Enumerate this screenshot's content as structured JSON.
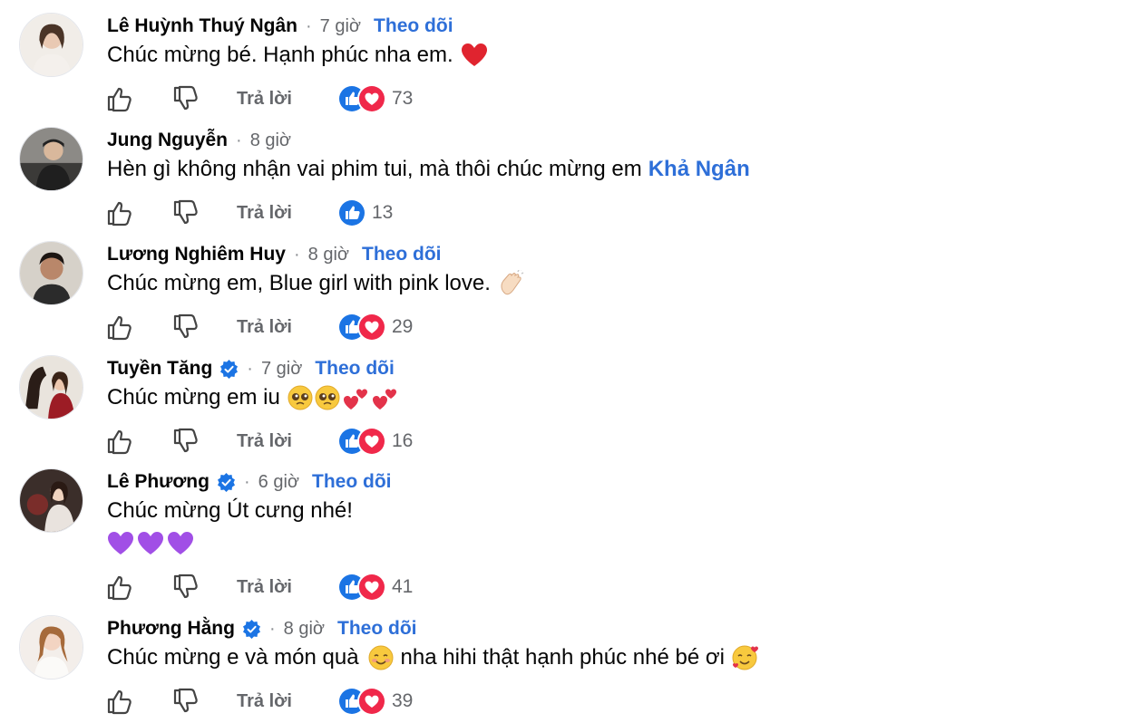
{
  "colors": {
    "link": "#2e6fd8",
    "name": "#050505",
    "meta": "#65676b",
    "like": "#1b74e4",
    "love": "#f0284a"
  },
  "labels": {
    "follow": "Theo dõi",
    "reply": "Trả lời",
    "dot": "·"
  },
  "comments": [
    {
      "name": "Lê Huỳnh Thuý Ngân",
      "time": "7 giờ",
      "verified": false,
      "show_follow": true,
      "text": "Chúc mừng bé. Hạnh phúc nha em.",
      "emoji": [
        "heart-emoji"
      ],
      "reactions": [
        "like",
        "love"
      ],
      "count": "73"
    },
    {
      "name": "Jung Nguyễn",
      "time": "8 giờ",
      "verified": false,
      "show_follow": false,
      "text": "Hèn gì không nhận vai phim tui, mà thôi chúc mừng em",
      "mention": "Khả Ngân",
      "reactions": [
        "like"
      ],
      "count": "13"
    },
    {
      "name": "Lương Nghiêm Huy",
      "time": "8 giờ",
      "verified": false,
      "show_follow": true,
      "text": "Chúc mừng em, Blue girl with pink love.",
      "emoji": [
        "clapping-hands-emoji"
      ],
      "reactions": [
        "like",
        "love"
      ],
      "count": "29"
    },
    {
      "name": "Tuyền Tăng",
      "time": "7 giờ",
      "verified": true,
      "show_follow": true,
      "text": "Chúc mừng em iu",
      "emoji": [
        "pleading-face-emoji",
        "pleading-face-emoji",
        "two-hearts-emoji",
        "two-hearts-emoji"
      ],
      "reactions": [
        "like",
        "love"
      ],
      "count": "16"
    },
    {
      "name": "Lê Phương",
      "time": "6 giờ",
      "verified": true,
      "show_follow": true,
      "text": "Chúc mừng Út cưng nhé!",
      "second_line_emoji": [
        "purple-heart-emoji",
        "purple-heart-emoji",
        "purple-heart-emoji"
      ],
      "reactions": [
        "like",
        "love"
      ],
      "count": "41"
    },
    {
      "name": "Phương Hằng",
      "time": "8 giờ",
      "verified": true,
      "show_follow": true,
      "text": "Chúc mừng e và món quà",
      "text_after": "nha hihi thật hạnh phúc nhé bé ơi",
      "emoji_mid": [
        "smiling-face-emoji"
      ],
      "emoji": [
        "smiling-face-with-hearts-emoji"
      ],
      "reactions": [
        "like",
        "love"
      ],
      "count": "39"
    }
  ]
}
